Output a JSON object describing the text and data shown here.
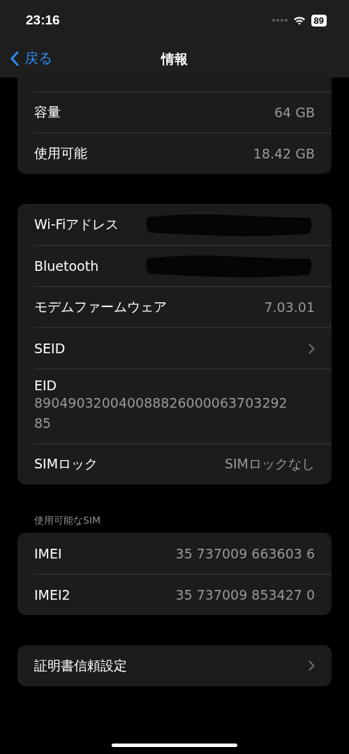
{
  "status_bar": {
    "time": "23:16",
    "battery": "89"
  },
  "nav": {
    "back": "戻る",
    "title": "情報"
  },
  "groups": [
    {
      "cut_top": true,
      "rows": [
        {
          "kind": "value",
          "label": "容量",
          "value": "64 GB"
        },
        {
          "kind": "value",
          "label": "使用可能",
          "value": "18.42 GB"
        }
      ]
    },
    {
      "rows": [
        {
          "kind": "redacted",
          "label": "Wi-Fiアドレス"
        },
        {
          "kind": "redacted",
          "label": "Bluetooth"
        },
        {
          "kind": "value",
          "label": "モデムファームウェア",
          "value": "7.03.01"
        },
        {
          "kind": "link",
          "label": "SEID"
        },
        {
          "kind": "stacked",
          "label": "EID",
          "value": "89049032004008882600006370329285"
        },
        {
          "kind": "value",
          "label": "SIMロック",
          "value": "SIMロックなし"
        }
      ]
    },
    {
      "header": "使用可能なSIM",
      "rows": [
        {
          "kind": "value",
          "label": "IMEI",
          "value": "35 737009 663603 6"
        },
        {
          "kind": "value",
          "label": "IMEI2",
          "value": "35 737009 853427 0"
        }
      ]
    },
    {
      "rows": [
        {
          "kind": "link",
          "label": "証明書信頼設定"
        }
      ]
    }
  ]
}
